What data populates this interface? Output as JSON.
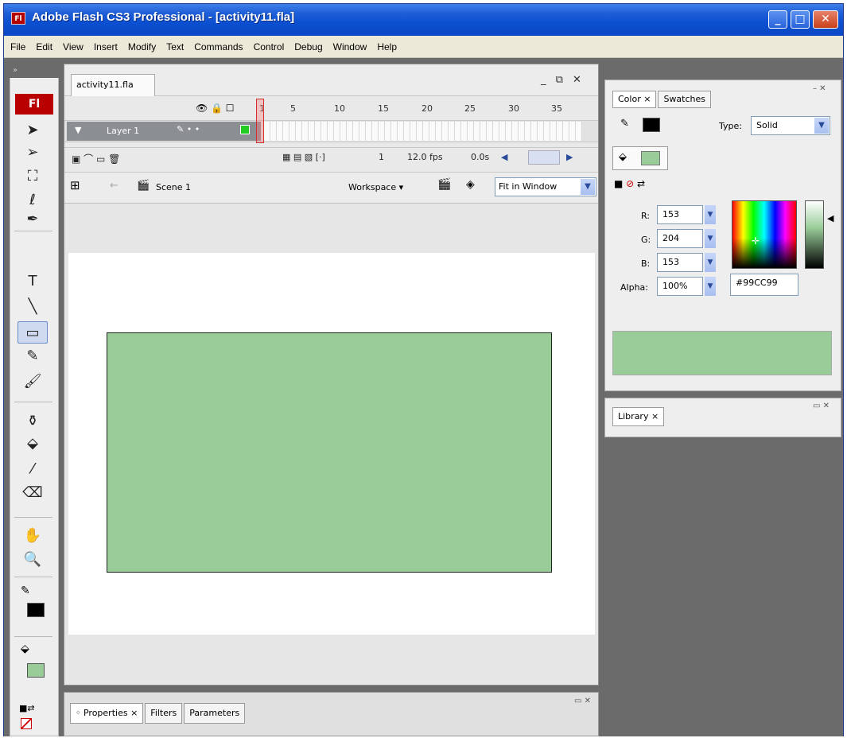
{
  "window": {
    "title": "Adobe Flash CS3 Professional - [activity11.fla]",
    "logo": "Fl",
    "controls": {
      "minimize": "_",
      "maximize": "□",
      "close": "✕"
    }
  },
  "menu": [
    "File",
    "Edit",
    "View",
    "Insert",
    "Modify",
    "Text",
    "Commands",
    "Control",
    "Debug",
    "Window",
    "Help"
  ],
  "tools": {
    "logo": "Fl",
    "items": [
      {
        "name": "selection-tool-icon",
        "glyph": "➤"
      },
      {
        "name": "subselection-tool-icon",
        "glyph": "➢"
      },
      {
        "name": "free-transform-tool-icon",
        "glyph": "⛶"
      },
      {
        "name": "lasso-tool-icon",
        "glyph": "ℓ"
      },
      {
        "name": "pen-tool-icon",
        "glyph": "✒"
      },
      {
        "name": "text-tool-icon",
        "glyph": "T"
      },
      {
        "name": "line-tool-icon",
        "glyph": "╲"
      },
      {
        "name": "rectangle-tool-icon",
        "glyph": "▭"
      },
      {
        "name": "pencil-tool-icon",
        "glyph": "✎"
      },
      {
        "name": "brush-tool-icon",
        "glyph": "🖌"
      },
      {
        "name": "ink-bottle-tool-icon",
        "glyph": "⚱"
      },
      {
        "name": "paint-bucket-tool-icon",
        "glyph": "⬙"
      },
      {
        "name": "eyedropper-tool-icon",
        "glyph": "⁄"
      },
      {
        "name": "eraser-tool-icon",
        "glyph": "⌫"
      },
      {
        "name": "hand-tool-icon",
        "glyph": "✋"
      },
      {
        "name": "zoom-tool-icon",
        "glyph": "🔍"
      }
    ],
    "stroke_color": "#000000",
    "fill_color": "#99cc99"
  },
  "document": {
    "tab": "activity11.fla",
    "window_controls": "_ ⧉ ✕",
    "timeline": {
      "frame_numbers": [
        "1",
        "5",
        "10",
        "15",
        "20",
        "25",
        "30",
        "35"
      ],
      "layer_name": "Layer 1",
      "current_frame": "1",
      "frame_rate": "12.0 fps",
      "elapsed": "0.0s"
    },
    "editbar": {
      "scene": "Scene 1",
      "workspace": "Workspace ▾",
      "zoom": "Fit in Window"
    },
    "shape_fill": "#99cc99"
  },
  "properties": {
    "tabs": [
      "◦ Properties ×",
      "Filters",
      "Parameters"
    ]
  },
  "color_panel": {
    "tabs": [
      "Color ×",
      "Swatches"
    ],
    "type_label": "Type:",
    "type_value": "Solid",
    "r_label": "R:",
    "r": "153",
    "g_label": "G:",
    "g": "204",
    "b_label": "B:",
    "b": "153",
    "alpha_label": "Alpha:",
    "alpha": "100%",
    "hex": "#99CC99",
    "preview_color": "#99cc99"
  },
  "library_panel": {
    "tab": "Library ×"
  }
}
